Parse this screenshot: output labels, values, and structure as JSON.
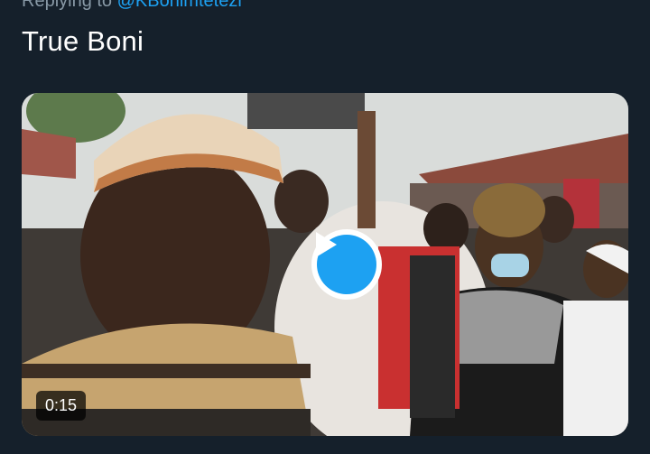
{
  "reply": {
    "prefix": "Replying to",
    "handle": "@KBonimtetezi"
  },
  "tweet": {
    "text": "True Boni"
  },
  "media": {
    "type": "video",
    "duration": "0:15",
    "play_icon": "play-icon"
  },
  "colors": {
    "background": "#15202b",
    "accent": "#1da1f2",
    "muted": "#8899a6"
  }
}
